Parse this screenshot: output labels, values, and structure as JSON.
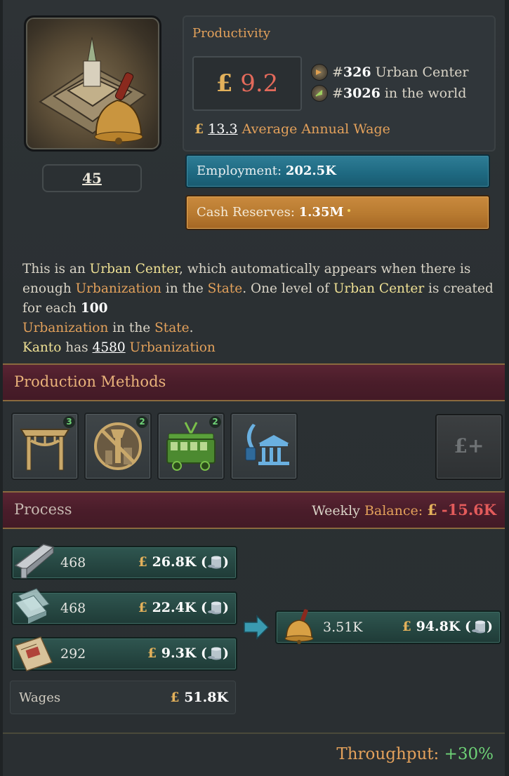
{
  "building": {
    "name": "Urban Center",
    "level": "45",
    "image_icon": "urban-center-bell-icon"
  },
  "productivity": {
    "title": "Productivity",
    "currency": "£",
    "value": "9.2",
    "rank_local_prefix": "#",
    "rank_local": "326",
    "rank_local_label": "Urban Center",
    "rank_world_prefix": "#",
    "rank_world": "3026",
    "rank_world_label": "in the world",
    "avg_wage": "13.3",
    "avg_wage_label": "Average Annual Wage"
  },
  "employment": {
    "label": "Employment:",
    "value": "202.5K"
  },
  "cash_reserves": {
    "label": "Cash Reserves:",
    "value": "1.35M"
  },
  "description": {
    "p1": "This is an ",
    "p2": "Urban Center",
    "p3": ", which automatically appears when there is enough ",
    "p4": "Urbanization",
    "p5": " in the ",
    "p6": "State",
    "p7": ". One level of ",
    "p8": "Urban Center",
    "p9": " is created for each ",
    "p10": "100",
    "p11": "Urbanization",
    "p12": " in the ",
    "p13": "State",
    "p14": ".",
    "state_name": "Kanto",
    "has": " has ",
    "urbanization_amount": "4580",
    "urbanization_label": "Urbanization"
  },
  "production_methods": {
    "title": "Production Methods",
    "methods": [
      {
        "icon": "covered-market-icon",
        "badge": "3"
      },
      {
        "icon": "no-street-lighting-icon",
        "badge": "2"
      },
      {
        "icon": "tram-icon",
        "badge": "2"
      },
      {
        "icon": "public-institution-icon",
        "badge": ""
      }
    ],
    "add_button_icon": "add-money-icon",
    "add_button_label": "£+"
  },
  "process": {
    "title": "Process",
    "balance_prefix": "Weekly",
    "balance_label": "Balance:",
    "balance_currency": "£",
    "balance_value": "-15.6K",
    "inputs": [
      {
        "icon": "steel-icon",
        "qty": "468",
        "currency": "£",
        "price": "26.8K",
        "open": "(",
        "close": ")"
      },
      {
        "icon": "glass-icon",
        "qty": "468",
        "currency": "£",
        "price": "22.4K",
        "open": "(",
        "close": ")"
      },
      {
        "icon": "services-ticket-icon",
        "qty": "292",
        "currency": "£",
        "price": "9.3K",
        "open": "(",
        "close": ")"
      }
    ],
    "wages_label": "Wages",
    "wages_currency": "£",
    "wages_value": "51.8K",
    "output": {
      "icon": "urban-services-bell-icon",
      "qty": "3.51K",
      "currency": "£",
      "price": "94.8K",
      "open": "(",
      "close": ")"
    }
  },
  "throughput": {
    "label": "Throughput:",
    "value": "+30%"
  },
  "colors": {
    "accent_orange": "#e3a15b",
    "highlight_yellow": "#eee094",
    "negative_red": "#e35b5b",
    "positive_green": "#6ed277",
    "employment_blue": "#2f7d96",
    "cash_orange": "#c98a3e",
    "section_maroon": "#4a1d2a"
  }
}
